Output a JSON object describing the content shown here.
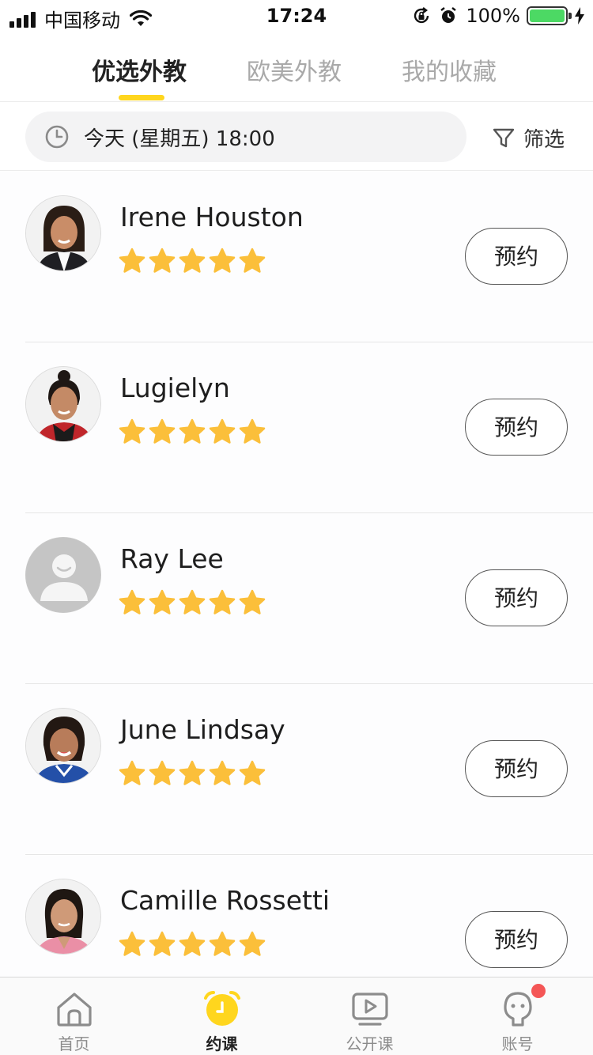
{
  "status_bar": {
    "carrier": "中国移动",
    "time": "17:24",
    "battery": "100%"
  },
  "tabs": [
    {
      "label": "优选外教",
      "active": true
    },
    {
      "label": "欧美外教",
      "active": false
    },
    {
      "label": "我的收藏",
      "active": false
    }
  ],
  "filter": {
    "date": "今天 (星期五) 18:00",
    "filter_label": "筛选"
  },
  "teachers": [
    {
      "name": "Irene Houston",
      "rating": 5,
      "book_label": "预约"
    },
    {
      "name": "Lugielyn",
      "rating": 5,
      "book_label": "预约"
    },
    {
      "name": "Ray Lee",
      "rating": 5,
      "book_label": "预约"
    },
    {
      "name": "June Lindsay",
      "rating": 5,
      "book_label": "预约"
    },
    {
      "name": "Camille Rossetti",
      "rating": 5,
      "book_label": "预约"
    }
  ],
  "bottom_nav": [
    {
      "label": "首页",
      "icon": "home-icon",
      "active": false
    },
    {
      "label": "约课",
      "icon": "alarm-clock-icon",
      "active": true
    },
    {
      "label": "公开课",
      "icon": "video-play-icon",
      "active": false
    },
    {
      "label": "账号",
      "icon": "account-icon",
      "active": false,
      "badge": true
    }
  ],
  "colors": {
    "accent": "#ffd61e",
    "star": "#fbbf3a",
    "badge": "#f45656",
    "battery": "#4cd964"
  }
}
